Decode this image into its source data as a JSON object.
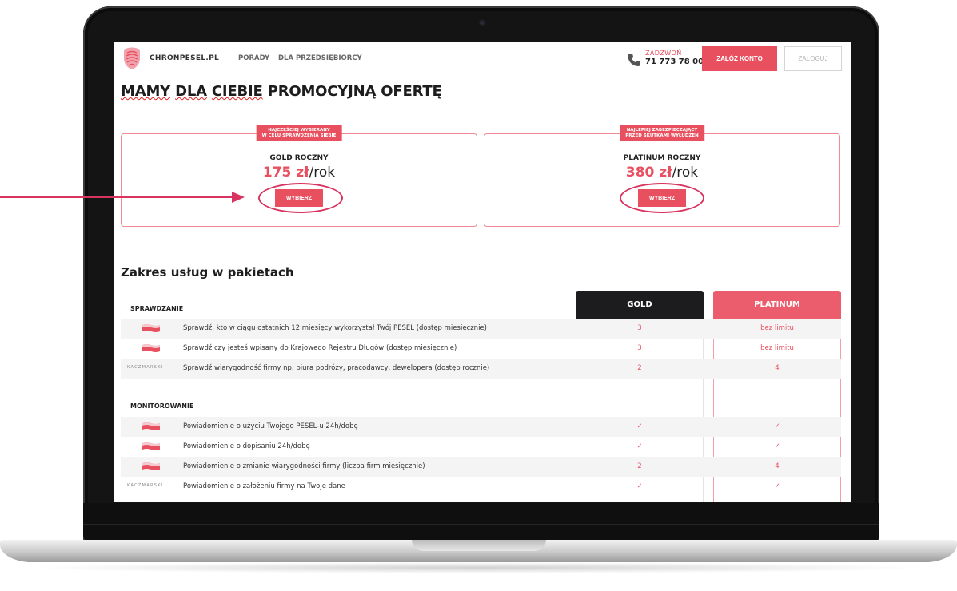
{
  "header": {
    "brand": "CHRONPESEL.PL",
    "nav": [
      "PORADY",
      "DLA PRZEDSIĘBIORCY"
    ],
    "call_label": "ZADZWOŃ",
    "phone": "71 773 78 00",
    "register_label": "ZAŁÓŻ KONTO",
    "login_label": "ZALOGUJ"
  },
  "title": {
    "part1": "MAMY",
    "part2": "DLA",
    "part3": "CIEBIE",
    "rest": "PROMOCYJNĄ OFERTĘ"
  },
  "offers": [
    {
      "badge_line1": "NAJCZĘŚCIEJ WYBIERANY",
      "badge_line2": "W CELU SPRAWDZENIA SIEBIE",
      "name": "GOLD ROCZNY",
      "price": "175 zł",
      "period": "/rok",
      "button": "WYBIERZ"
    },
    {
      "badge_line1": "NAJLEPIEJ ZABEZPIECZAJĄCY",
      "badge_line2": "PRZED SKUTKAMI WYŁUDZEŃ",
      "name": "PLATINUM ROCZNY",
      "price": "380 zł",
      "period": "/rok",
      "button": "WYBIERZ"
    }
  ],
  "services": {
    "title": "Zakres usług w pakietach",
    "columns": [
      "GOLD",
      "PLATINUM"
    ],
    "groups": [
      {
        "label": "SPRAWDZANIE",
        "rows": [
          {
            "icon": "flag-logo-icon",
            "text": "Sprawdź, kto w ciągu ostatnich 12 miesięcy wykorzystał Twój PESEL (dostęp miesięcznie)",
            "gold": "3",
            "platinum": "bez limitu"
          },
          {
            "icon": "flag-logo-icon",
            "text": "Sprawdź czy jesteś wpisany do Krajowego Rejestru Długów (dostęp miesięcznie)",
            "gold": "3",
            "platinum": "bez limitu"
          },
          {
            "icon": "kaczmarski-logo",
            "text": "Sprawdź wiarygodność firmy np. biura podróży, pracodawcy, dewelopera (dostęp rocznie)",
            "gold": "2",
            "platinum": "4"
          }
        ]
      },
      {
        "label": "MONITOROWANIE",
        "rows": [
          {
            "icon": "flag-logo-icon",
            "text": "Powiadomienie o użyciu Twojego PESEL-u 24h/dobę",
            "gold": "✓",
            "platinum": "✓"
          },
          {
            "icon": "flag-logo-icon",
            "text": "Powiadomienie o dopisaniu 24h/dobę",
            "gold": "✓",
            "platinum": "✓"
          },
          {
            "icon": "flag-logo-icon",
            "text": "Powiadomienie o zmianie wiarygodności firmy (liczba firm miesięcznie)",
            "gold": "2",
            "platinum": "4"
          },
          {
            "icon": "kaczmarski-logo",
            "text": "Powiadomienie o założeniu firmy na Twoje dane",
            "gold": "✓",
            "platinum": "✓"
          }
        ]
      }
    ]
  },
  "kaczmarski_text": "KACZMARSKI",
  "colors": {
    "accent": "#e9505f",
    "dark": "#1c1b1e",
    "annotation": "#d8345f"
  }
}
